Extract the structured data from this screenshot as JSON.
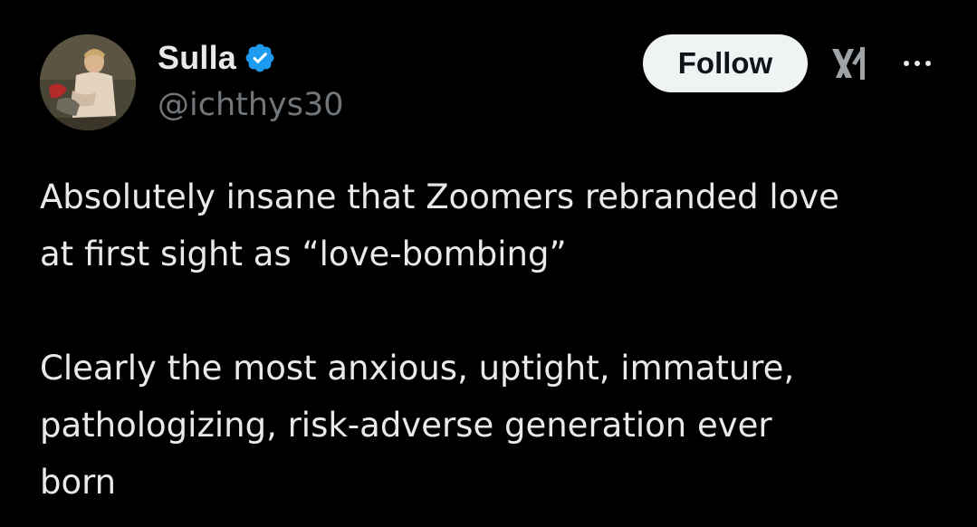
{
  "author": {
    "display_name": "Sulla",
    "handle": "@ichthys30",
    "verified_icon": "verified-badge-icon",
    "avatar_icon": "profile-avatar"
  },
  "actions": {
    "follow_label": "Follow",
    "x_logo_icon": "x-logo-icon",
    "more_icon": "more-options-icon"
  },
  "tweet": {
    "paragraph_1": "Absolutely insane that Zoomers rebranded love\nat first sight as “love-bombing”",
    "paragraph_2": "Clearly the most anxious, uptight, immature,\npathologizing, risk-adverse generation ever\nborn"
  },
  "colors": {
    "background": "#000000",
    "text": "#e7e9ea",
    "secondary_text": "#71767b",
    "follow_button_bg": "#eff3f4",
    "verified_blue": "#1d9bf0"
  }
}
